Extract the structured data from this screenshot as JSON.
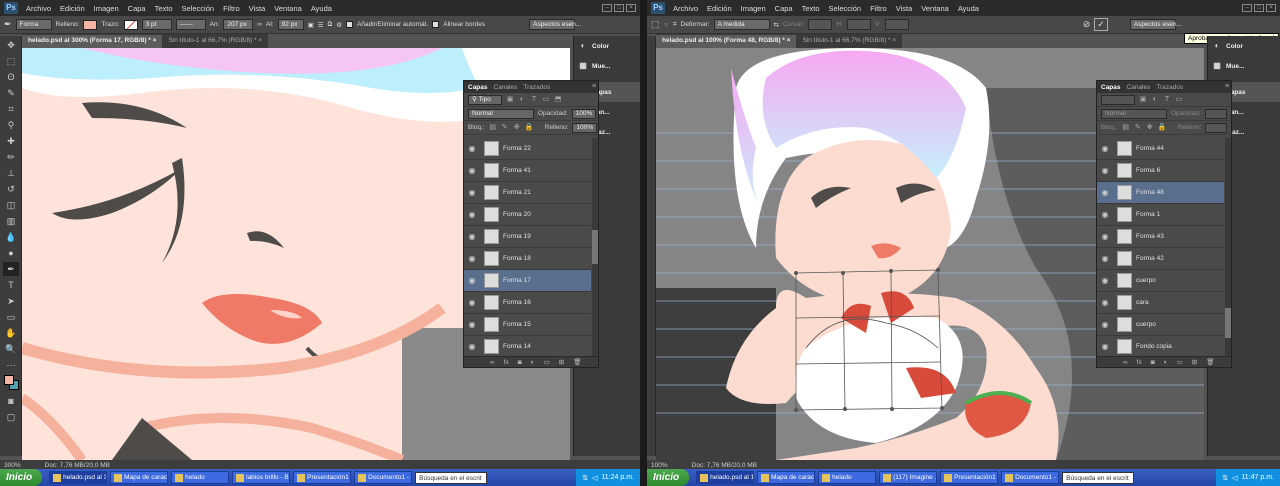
{
  "app": {
    "logo": "Ps"
  },
  "menu": [
    "Archivo",
    "Edición",
    "Imagen",
    "Capa",
    "Texto",
    "Selección",
    "Filtro",
    "Vista",
    "Ventana",
    "Ayuda"
  ],
  "left": {
    "options": {
      "shape": "Forma",
      "fill_label": "Relleno:",
      "stroke_label": "Trazo:",
      "stroke_size": "3 pt",
      "w_label": "An:",
      "w_value": "207 px",
      "h_label": "Al:",
      "h_value": "92 px",
      "auto_add_label": "Añadir/Eliminar automát.",
      "align_label": "Alinear bordes",
      "workspace": "Aspectos esen..."
    },
    "tabs": [
      "helado.psd al 300% (Forma 17, RGB/8) *",
      "Sin título-1 al 66,7% (RGB/8) *"
    ],
    "status": {
      "zoom": "300%",
      "doc": "Doc: 7,76 MB/20,0 MB"
    },
    "dock": [
      {
        "icon": "color-icon",
        "label": "Color"
      },
      {
        "icon": "swatches-icon",
        "label": "Mue..."
      },
      {
        "icon": "layers-icon",
        "label": "Capas"
      },
      {
        "icon": "channels-icon",
        "label": "Can..."
      },
      {
        "icon": "paths-icon",
        "label": "Traz..."
      }
    ],
    "layers": {
      "tabs": [
        "Capas",
        "Canales",
        "Trazados"
      ],
      "kind": "Tipo",
      "blend": "Normal",
      "opacity_label": "Opacidad:",
      "opacity": "100%",
      "lock_label": "Bloq.:",
      "fill_label": "Relleno:",
      "fill": "100%",
      "items": [
        {
          "name": "Forma 22",
          "selected": false
        },
        {
          "name": "Forma 41",
          "selected": false
        },
        {
          "name": "Forma 21",
          "selected": false
        },
        {
          "name": "Forma 20",
          "selected": false
        },
        {
          "name": "Forma 19",
          "selected": false
        },
        {
          "name": "Forma 18",
          "selected": false
        },
        {
          "name": "Forma 17",
          "selected": true
        },
        {
          "name": "Forma 16",
          "selected": false
        },
        {
          "name": "Forma 15",
          "selected": false
        },
        {
          "name": "Forma 14",
          "selected": false
        }
      ]
    },
    "taskbar": {
      "start": "Inicio",
      "items": [
        "helado.psd al 3...",
        "Mapa de carac...",
        "helado",
        "labios brillo - B...",
        "Presentación1 ...",
        "Documento1 - ..."
      ],
      "search": "Búsqueda en el escrit",
      "time": "11:24 p.m."
    }
  },
  "right": {
    "options": {
      "deform_label": "Deformar:",
      "deform_value": "A medida",
      "curve_label": "Curvar:",
      "h_label": "H:",
      "v_label": "V:",
      "workspace": "Aspectos esen..."
    },
    "tabs": [
      "helado.psd al 100% (Forma 48, RGB/8) *",
      "Sin título-1 al 66,7% (RGB/8) *"
    ],
    "tooltip": "Aprobar transformación (Intro)",
    "status": {
      "zoom": "100%",
      "doc": "Doc: 7,76 MB/20,0 MB"
    },
    "dock": [
      {
        "icon": "color-icon",
        "label": "Color"
      },
      {
        "icon": "swatches-icon",
        "label": "Mue..."
      },
      {
        "icon": "layers-icon",
        "label": "Capas"
      },
      {
        "icon": "channels-icon",
        "label": "Can..."
      },
      {
        "icon": "paths-icon",
        "label": "Traz..."
      }
    ],
    "layers": {
      "tabs": [
        "Capas",
        "Canales",
        "Trazados"
      ],
      "blend": "Normal",
      "opacity_label": "Opacidad:",
      "lock_label": "Bloq.:",
      "fill_label": "Relleno:",
      "items": [
        {
          "name": "Forma 44",
          "selected": false
        },
        {
          "name": "Forma 6",
          "selected": false
        },
        {
          "name": "Forma 48",
          "selected": true
        },
        {
          "name": "Forma 1",
          "selected": false
        },
        {
          "name": "Forma 43",
          "selected": false
        },
        {
          "name": "Forma 42",
          "selected": false
        },
        {
          "name": "cuerpo",
          "selected": false
        },
        {
          "name": "cara",
          "selected": false
        },
        {
          "name": "cuerpo",
          "selected": false
        },
        {
          "name": "Fondo copia",
          "selected": false
        }
      ]
    },
    "taskbar": {
      "start": "Inicio",
      "items": [
        "helado.psd al 1...",
        "Mapa de carac...",
        "helado",
        "(117) Imagine ...",
        "Presentación1 ...",
        "Documento1 - ..."
      ],
      "search": "Búsqueda en el escrit",
      "time": "11:47 p.m."
    }
  },
  "colors": {
    "fill_swatch": "#f4b5a4",
    "foreground": "#f4b5a4",
    "background": "#55a0b0",
    "selection": "#5a6e8e"
  }
}
